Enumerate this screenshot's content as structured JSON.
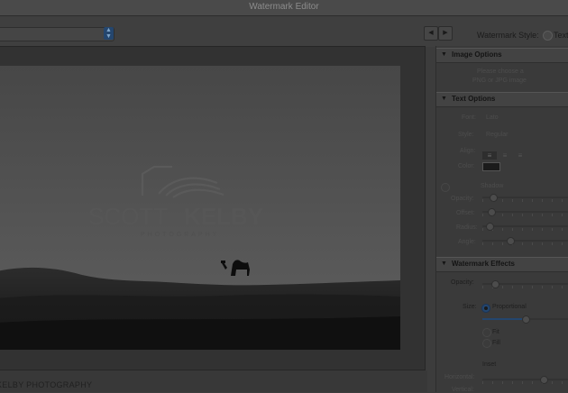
{
  "window": {
    "title": "Watermark Editor"
  },
  "toolbar": {
    "prev_icon": "triangle-left-icon",
    "next_icon": "triangle-right-icon",
    "style_label": "Watermark Style:",
    "style_option_text": "Text"
  },
  "preview": {
    "photo_label": "KELBY PHOTOGRAPHY",
    "watermark": {
      "brand_light": "SCOTT",
      "brand_bold": "KELBY",
      "tagline": "PHOTOGRAPHY"
    }
  },
  "panel": {
    "image_options": {
      "title": "Image Options",
      "message_line1": "Please choose a",
      "message_line2": "PNG or JPG image"
    },
    "text_options": {
      "title": "Text Options",
      "font_label": "Font:",
      "font_value": "Lato",
      "style_label": "Style:",
      "style_value": "Regular",
      "align_label": "Align:",
      "align_icons": [
        "align-left-icon",
        "align-center-icon",
        "align-right-icon"
      ],
      "color_label": "Color:",
      "shadow_label": "Shadow",
      "opacity_label": "Opacity:",
      "offset_label": "Offset:",
      "radius_label": "Radius:",
      "angle_label": "Angle:"
    },
    "effects": {
      "title": "Watermark Effects",
      "opacity_label": "Opacity:",
      "size_label": "Size:",
      "size_options": [
        "Proportional",
        "Fit",
        "Fill"
      ],
      "size_selected": "Proportional",
      "size_slider_fraction": 0.5,
      "inset_label": "Inset",
      "horizontal_label": "Horizontal:",
      "vertical_label": "Vertical:"
    }
  },
  "colors": {
    "accent": "#24466e",
    "background": "#3c3c3c"
  }
}
